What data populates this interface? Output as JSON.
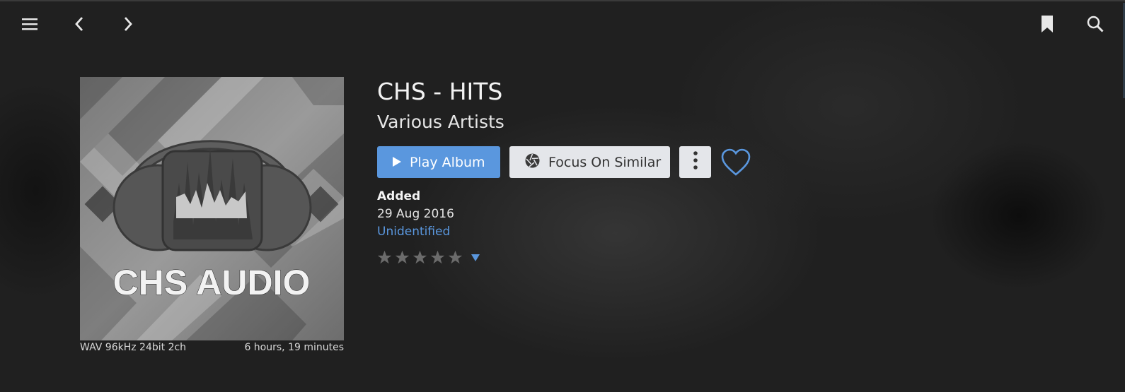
{
  "topbar": {
    "menu_icon": "hamburger-menu-icon",
    "back_icon": "chevron-left-icon",
    "forward_icon": "chevron-right-icon",
    "bookmark_icon": "bookmark-icon",
    "search_icon": "search-icon"
  },
  "album": {
    "art_text": "CHS AUDIO",
    "format": "WAV 96kHz 24bit 2ch",
    "duration": "6 hours, 19 minutes",
    "title": "CHS - HITS",
    "artist": "Various Artists"
  },
  "actions": {
    "play_label": "Play Album",
    "focus_label": "Focus On Similar",
    "more_icon": "vertical-dots-icon",
    "favorite_icon": "heart-outline-icon"
  },
  "details": {
    "added_label": "Added",
    "added_date": "29 Aug 2016",
    "status": "Unidentified"
  },
  "rating": {
    "value": 0,
    "max": 5
  },
  "colors": {
    "accent": "#5a97de",
    "secondary_button": "#e4e6ea",
    "background": "#202020"
  }
}
